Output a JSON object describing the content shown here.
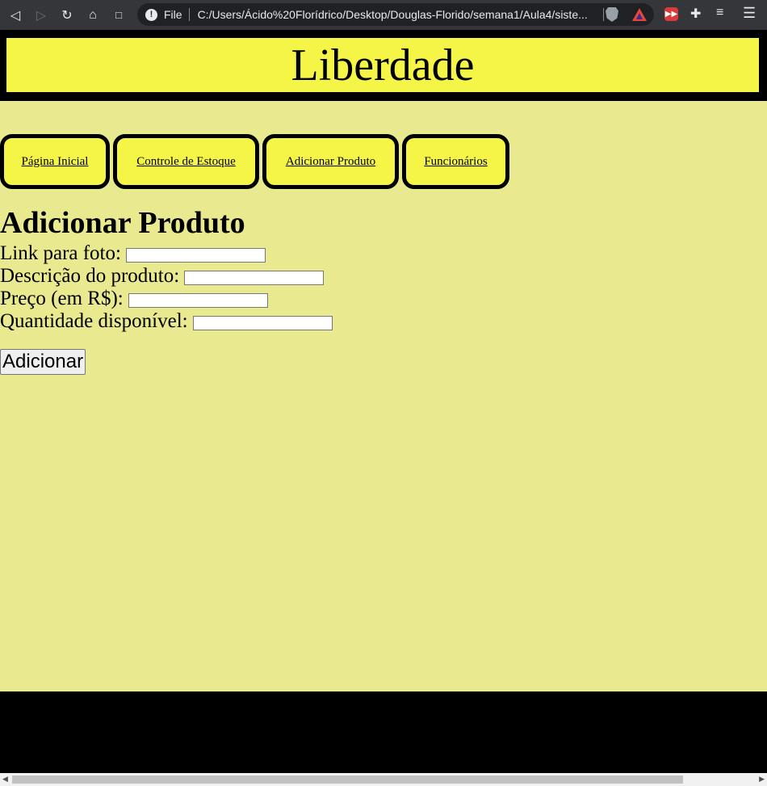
{
  "browser": {
    "file_label": "File",
    "url": "C:/Users/Ácido%20Florídrico/Desktop/Douglas-Florido/semana1/Aula4/siste...",
    "info_icon_glyph": "!",
    "icons": {
      "back": "◁",
      "forward": "▷",
      "reload": "↻",
      "home": "⌂",
      "bookmark": "🔖",
      "ext1": "▶▶",
      "puzzle": "✚",
      "playlist": "≡",
      "menu": "☰"
    }
  },
  "header": {
    "title": "Liberdade"
  },
  "nav": {
    "items": [
      {
        "label": "Página Inicial"
      },
      {
        "label": "Controle de Estoque"
      },
      {
        "label": "Adicionar Produto"
      },
      {
        "label": "Funcionários"
      }
    ]
  },
  "form": {
    "heading": "Adicionar Produto",
    "fields": [
      {
        "label": "Link para foto:",
        "value": ""
      },
      {
        "label": "Descrição do produto:",
        "value": ""
      },
      {
        "label": "Preço (em R$):",
        "value": ""
      },
      {
        "label": "Quantidade disponível:",
        "value": ""
      }
    ],
    "submit_label": "Adicionar"
  },
  "scrollbar": {
    "left_arrow": "◀",
    "right_arrow": "▶"
  },
  "colors": {
    "page_bg": "#e9e98f",
    "header_bg": "#f5f547",
    "nav_bg": "#f5f547",
    "border": "#000000"
  }
}
